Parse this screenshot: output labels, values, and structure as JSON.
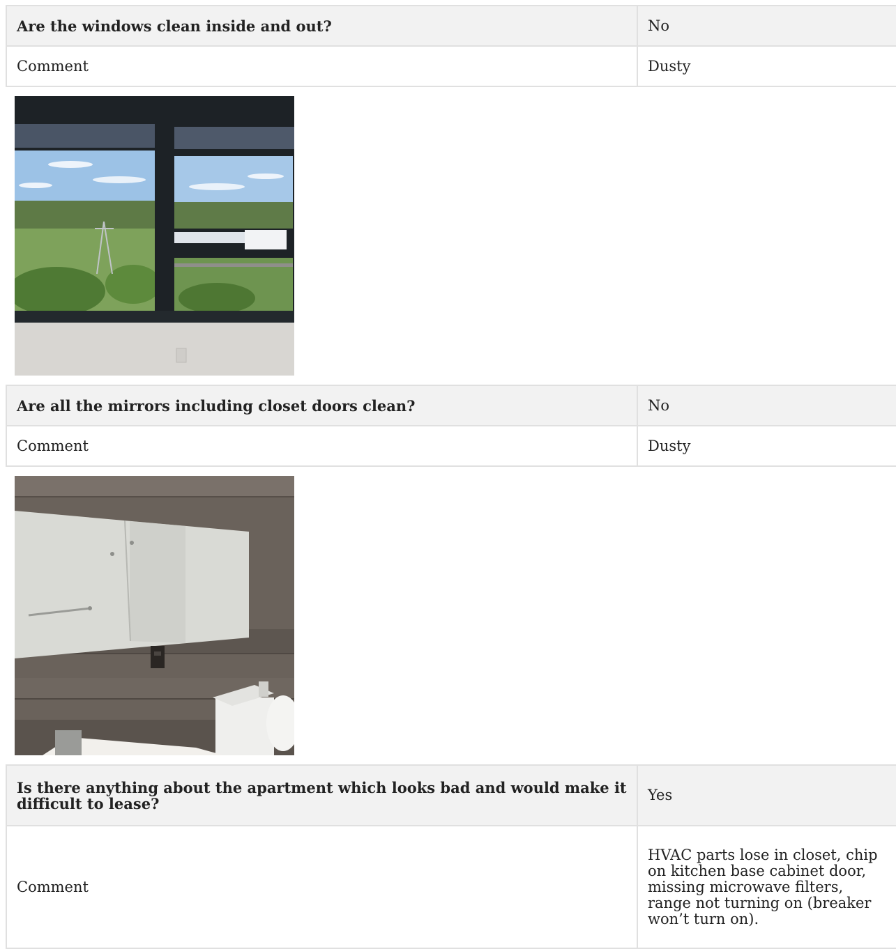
{
  "items": [
    {
      "question": "Are the windows clean inside and out?",
      "answer": "No",
      "comment_label": "Comment",
      "comment": "Dusty",
      "photo": "window-view-photo"
    },
    {
      "question": "Are all the mirrors including closet doors clean?",
      "answer": "No",
      "comment_label": "Comment",
      "comment": "Dusty",
      "photo": "bathroom-mirror-photo"
    },
    {
      "question": "Is there anything about the apartment which looks bad and would make it difficult to lease?",
      "answer": "Yes",
      "comment_label": "Comment",
      "comment": "HVAC parts lose in closet, chip on kitchen base cabinet door, missing microwave filters, range not turning on (breaker won’t turn on)."
    }
  ]
}
